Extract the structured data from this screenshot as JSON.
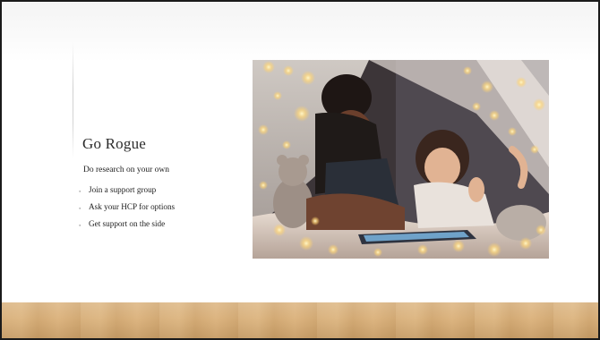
{
  "slide": {
    "title": "Go Rogue",
    "subtitle": "Do research on your own",
    "bullets": [
      "Join a support group",
      "Ask your HCP for options",
      "Get support on the side"
    ],
    "bullet_glyph": "▪"
  },
  "photo": {
    "subject": "photo-mother-daughter-tent-fairy-lights"
  },
  "colors": {
    "title": "#2b2b2b",
    "text": "#222222",
    "floor": "#d6ac74"
  }
}
